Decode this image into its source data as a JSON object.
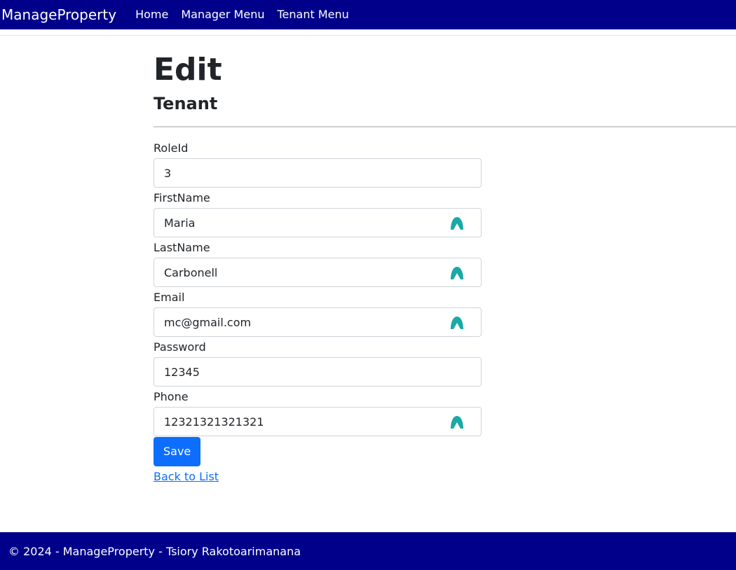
{
  "navbar": {
    "brand": "ManageProperty",
    "links": [
      "Home",
      "Manager Menu",
      "Tenant Menu"
    ],
    "background": "#00008b"
  },
  "page": {
    "title": "Edit",
    "subtitle": "Tenant"
  },
  "form": {
    "fields": [
      {
        "label": "RoleId",
        "value": "3",
        "autofill_icon": false
      },
      {
        "label": "FirstName",
        "value": "Maria",
        "autofill_icon": true
      },
      {
        "label": "LastName",
        "value": "Carbonell",
        "autofill_icon": true
      },
      {
        "label": "Email",
        "value": "mc@gmail.com",
        "autofill_icon": true
      },
      {
        "label": "Password",
        "value": "12345",
        "autofill_icon": false
      },
      {
        "label": "Phone",
        "value": "12321321321321",
        "autofill_icon": true
      }
    ],
    "save_label": "Save",
    "back_link": "Back to List",
    "primary_color": "#0d6efd",
    "autofill_icon_name": "password-manager-icon",
    "autofill_icon_color": "#1aa8a8"
  },
  "footer": {
    "text": "© 2024 - ManageProperty - Tsiory Rakotoarimanana"
  }
}
